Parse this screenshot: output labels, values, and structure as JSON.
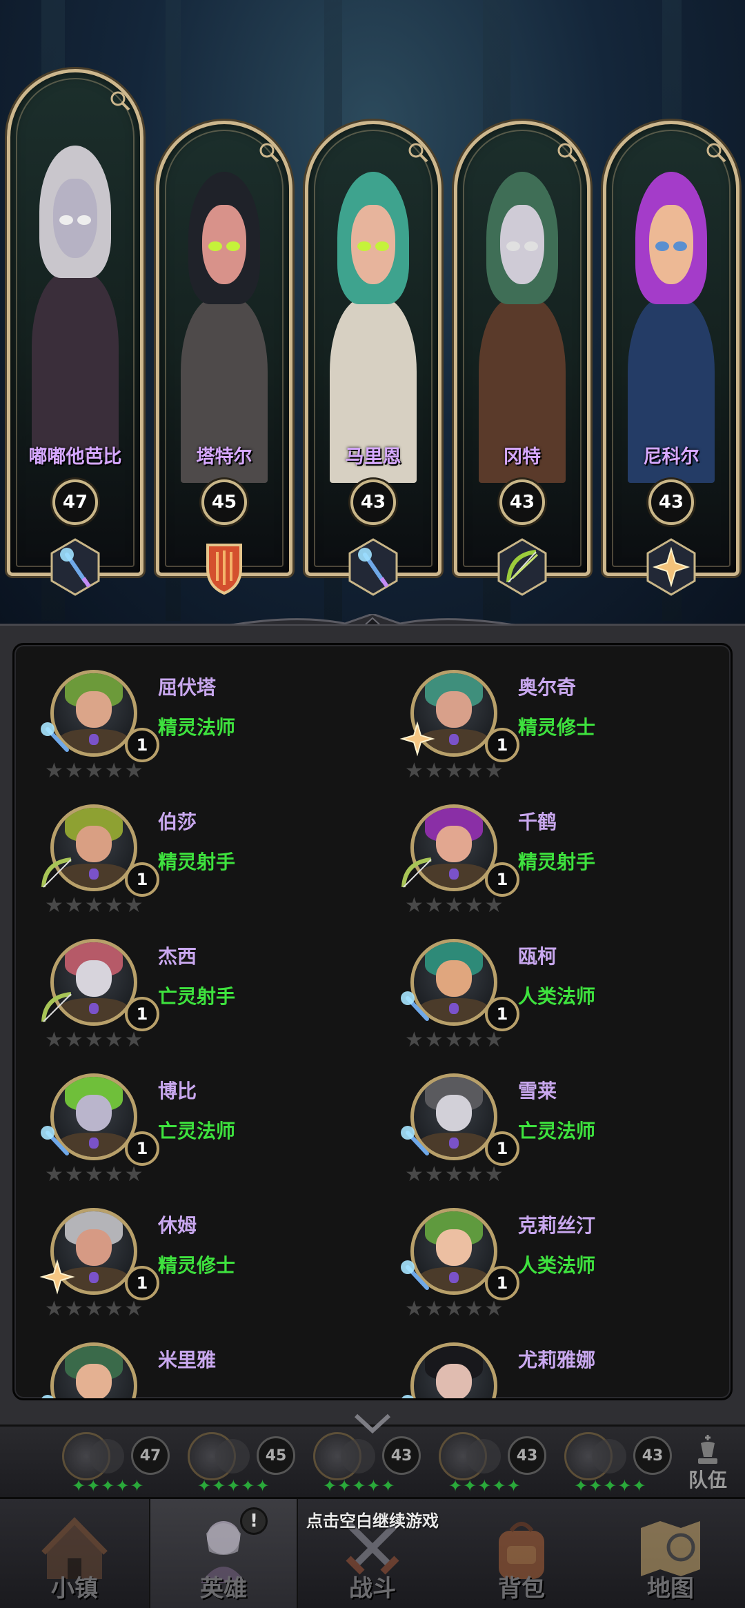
{
  "lineup": [
    {
      "name": "嘟嘟他芭比",
      "level": "47",
      "class_icon": "staff-icon",
      "hair": "#c9c6cc",
      "skin": "#b6b2c4",
      "eye": "#eeeeee",
      "body": "#3a2e3a"
    },
    {
      "name": "塔特尔",
      "level": "45",
      "class_icon": "shield-icon",
      "hair": "#1f2229",
      "skin": "#d8928a",
      "eye": "#c5f23a",
      "body": "#4e4a4a"
    },
    {
      "name": "马里恩",
      "level": "43",
      "class_icon": "staff-icon",
      "hair": "#3ea38e",
      "skin": "#e7b49c",
      "eye": "#c5f23a",
      "body": "#d7d0c2"
    },
    {
      "name": "冈特",
      "level": "43",
      "class_icon": "bow-icon",
      "hair": "#3f6e56",
      "skin": "#cfcbd6",
      "eye": "#e0e0e0",
      "body": "#5a3a2a"
    },
    {
      "name": "尼科尔",
      "level": "43",
      "class_icon": "holy-star-icon",
      "hair": "#a43cc9",
      "skin": "#edb995",
      "eye": "#5a8fd0",
      "body": "#243c66"
    }
  ],
  "roster": [
    {
      "name": "屈伏塔",
      "class": "精灵法师",
      "stars": "1",
      "class_icon": "staff-icon",
      "hair": "#6c9a3a",
      "skin": "#dba589"
    },
    {
      "name": "奥尔奇",
      "class": "精灵修士",
      "stars": "1",
      "class_icon": "holy-star-icon",
      "hair": "#3f8f7c",
      "skin": "#d8a08a"
    },
    {
      "name": "伯莎",
      "class": "精灵射手",
      "stars": "1",
      "class_icon": "bow-icon",
      "hair": "#8ea132",
      "skin": "#d99f83"
    },
    {
      "name": "千鹤",
      "class": "精灵射手",
      "stars": "1",
      "class_icon": "bow-icon",
      "hair": "#8a2fa6",
      "skin": "#e2a790"
    },
    {
      "name": "杰西",
      "class": "亡灵射手",
      "stars": "1",
      "class_icon": "bow-icon",
      "hair": "#b65a68",
      "skin": "#d7d4dc"
    },
    {
      "name": "瓯柯",
      "class": "人类法师",
      "stars": "1",
      "class_icon": "staff-icon",
      "hair": "#2e8a78",
      "skin": "#e0a67e"
    },
    {
      "name": "博比",
      "class": "亡灵法师",
      "stars": "1",
      "class_icon": "staff-icon",
      "hair": "#6fbf3a",
      "skin": "#bab5cc"
    },
    {
      "name": "雪莱",
      "class": "亡灵法师",
      "stars": "1",
      "class_icon": "staff-icon",
      "hair": "#5a5a5e",
      "skin": "#d2d0d8"
    },
    {
      "name": "休姆",
      "class": "精灵修士",
      "stars": "1",
      "class_icon": "holy-star-icon",
      "hair": "#b4b4b8",
      "skin": "#d69a84"
    },
    {
      "name": "克莉丝汀",
      "class": "人类法师",
      "stars": "1",
      "class_icon": "staff-icon",
      "hair": "#5f9a3e",
      "skin": "#ecbfa2"
    },
    {
      "name": "米里雅",
      "class": "",
      "stars": "",
      "class_icon": "staff-icon",
      "hair": "#3a6a4a",
      "skin": "#e4b192"
    },
    {
      "name": "尤莉雅娜",
      "class": "",
      "stars": "",
      "class_icon": "staff-icon",
      "hair": "#18181c",
      "skin": "#e0bcb0"
    }
  ],
  "team_strip": {
    "levels": [
      "47",
      "45",
      "43",
      "43",
      "43"
    ],
    "button_label": "队伍"
  },
  "hint": "点击空白继续游戏",
  "nav": [
    {
      "label": "小镇",
      "icon": "town-icon"
    },
    {
      "label": "英雄",
      "icon": "hero-icon"
    },
    {
      "label": "战斗",
      "icon": "swords-icon"
    },
    {
      "label": "背包",
      "icon": "backpack-icon"
    },
    {
      "label": "地图",
      "icon": "map-icon"
    }
  ],
  "hero_nav_badge": "!",
  "colors": {
    "name_purple": "#c9a8ef",
    "class_green": "#3ee23e",
    "frame_gold": "#cdb78d"
  }
}
